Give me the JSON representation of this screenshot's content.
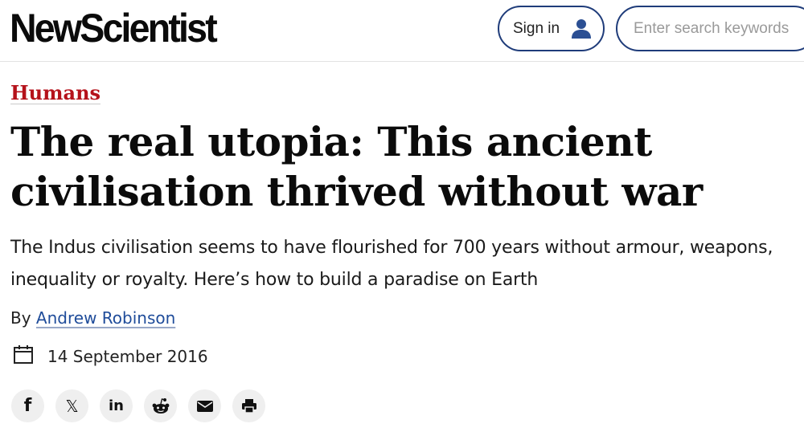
{
  "header": {
    "logo_text": "NewScientist",
    "signin_label": "Sign in",
    "search_placeholder": "Enter search keywords"
  },
  "article": {
    "category": "Humans",
    "headline": "The real utopia: This ancient civilisation thrived without war",
    "standfirst": "The Indus civilisation seems to have flourished for 700 years without armour, weapons, inequality or royalty. Here’s how to build a paradise on Earth",
    "byline_prefix": "By",
    "author": "Andrew Robinson",
    "date": "14 September 2016"
  },
  "share": {
    "facebook_glyph": "f",
    "x_glyph": "𝕏",
    "linkedin_glyph": "in",
    "icons": [
      "facebook-icon",
      "x-icon",
      "linkedin-icon",
      "reddit-icon",
      "email-icon",
      "print-icon"
    ]
  },
  "colors": {
    "category_red": "#b5121b",
    "border_navy": "#1f3c7a",
    "link_blue": "#1f4c9a",
    "share_bg": "#efefef"
  }
}
